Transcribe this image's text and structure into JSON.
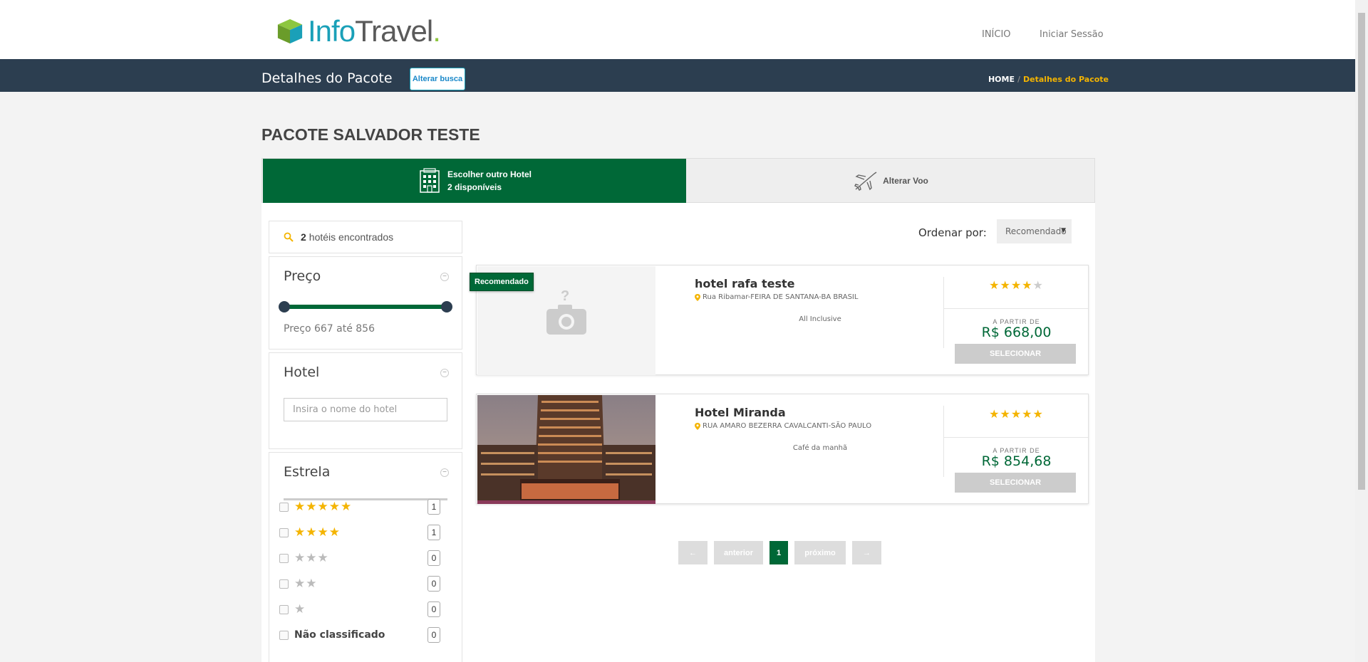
{
  "brand": {
    "name_part1": "Info",
    "name_part2": "Travel",
    "name_dot": "."
  },
  "nav": {
    "home": "INÍCIO",
    "login": "Iniciar Sessão"
  },
  "header": {
    "title": "Detalhes do Pacote",
    "alter_search": "Alterar busca"
  },
  "breadcrumb": {
    "home": "HOME",
    "separator": "/",
    "current": "Detalhes do Pacote"
  },
  "package_title": "PACOTE SALVADOR TESTE",
  "tabs": {
    "hotel": {
      "label": "Escolher outro Hotel",
      "sub": "2 disponíveis"
    },
    "flight": {
      "label": "Alterar Voo"
    }
  },
  "filters": {
    "found_count": "2",
    "found_label": "hotéis encontrados",
    "price": {
      "title": "Preço",
      "range_text": "Preço 667 até 856",
      "min_fraction": 0,
      "max_fraction": 1
    },
    "hotel": {
      "title": "Hotel",
      "placeholder": "Insira o nome do hotel"
    },
    "stars": {
      "title": "Estrela",
      "rows": [
        {
          "stars": "★★★★★",
          "count": "1"
        },
        {
          "stars": "★★★★",
          "count": "1"
        },
        {
          "stars": "★★★",
          "count": "0"
        },
        {
          "stars": "★★",
          "count": "0"
        },
        {
          "stars": "★",
          "count": "0"
        }
      ],
      "unrated": {
        "label": "Não classificado",
        "count": "0"
      }
    }
  },
  "sort": {
    "label": "Ordenar por:",
    "value": "Recomendado"
  },
  "hotels": [
    {
      "badge": "Recomendado",
      "name": "hotel rafa teste",
      "address": "Rua Ribamar-FEIRA DE SANTANA-BA BRASIL",
      "board": "All Inclusive",
      "stars_filled": "★★★★",
      "stars_empty": "★",
      "from_label": "A PARTIR DE",
      "price": "R$ 668,00",
      "button": "SELECIONAR"
    },
    {
      "name": "Hotel Miranda",
      "address": "RUA AMARO BEZERRA CAVALCANTI-SÃO PAULO",
      "board": "Café da manhã",
      "stars_filled": "★★★★★",
      "stars_empty": "",
      "from_label": "A PARTIR DE",
      "price": "R$ 854,68",
      "button": "SELECIONAR"
    }
  ],
  "pagination": {
    "first": "←",
    "prev": "anterior",
    "current": "1",
    "next": "próximo",
    "last": "→"
  },
  "colors": {
    "primary_green": "#006837",
    "navy": "#2c3e50",
    "star_gold": "#f4b400",
    "accent_orange": "#f4b400"
  },
  "icons": [
    "search-icon",
    "hotel-building-icon",
    "airplane-icon",
    "map-pin-icon",
    "camera-placeholder-icon"
  ]
}
